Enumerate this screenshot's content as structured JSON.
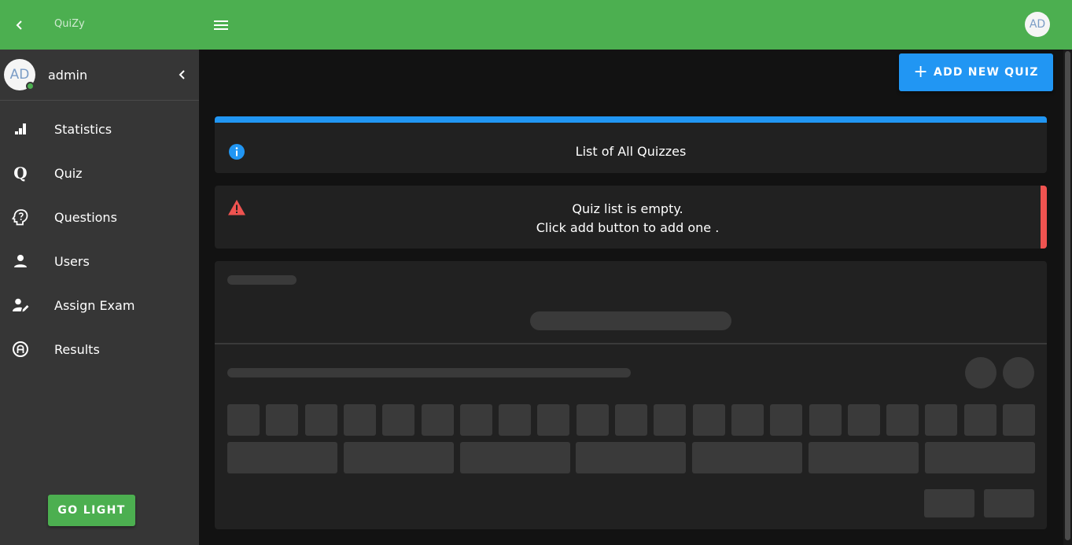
{
  "header": {
    "app_title": "QuiZy",
    "avatar_initials": "AD"
  },
  "sidebar": {
    "profile": {
      "avatar_initials": "AD",
      "username": "admin"
    },
    "items": [
      {
        "label": "Statistics",
        "icon": "bar-chart-icon"
      },
      {
        "label": "Quiz",
        "icon": "quiz-q-icon"
      },
      {
        "label": "Questions",
        "icon": "head-question-icon"
      },
      {
        "label": "Users",
        "icon": "user-icon"
      },
      {
        "label": "Assign Exam",
        "icon": "assign-pen-icon"
      },
      {
        "label": "Results",
        "icon": "alpha-a-circle-icon"
      }
    ],
    "theme_button": "GO LIGHT"
  },
  "main": {
    "add_button": "ADD NEW QUIZ",
    "info_title": "List of All Quizzes",
    "alert_line1": "Quiz list is empty.",
    "alert_line2": "Click add button to add one ."
  },
  "colors": {
    "primary_green": "#4caf50",
    "accent_blue": "#2196f3",
    "error_red": "#ef5350",
    "background": "#121212",
    "sidebar": "#363636",
    "card": "#212121"
  }
}
